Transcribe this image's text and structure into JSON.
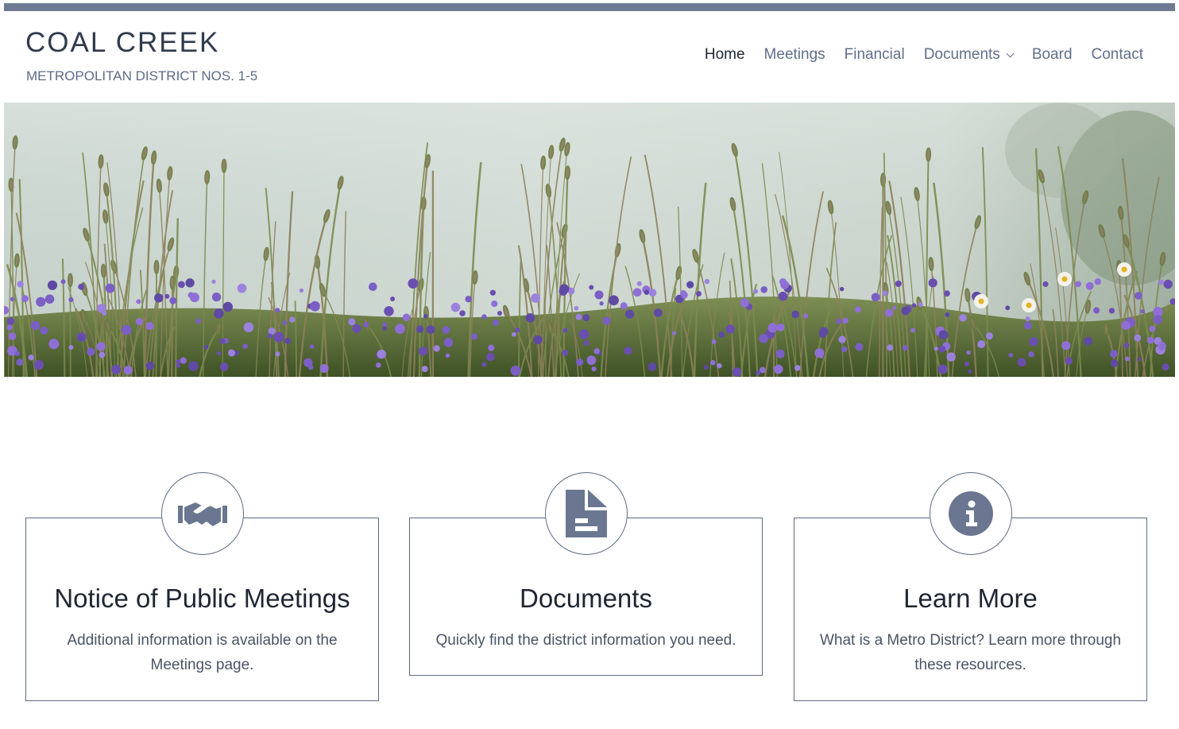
{
  "header": {
    "title": "COAL CREEK",
    "subtitle": "METROPOLITAN DISTRICT NOS. 1-5"
  },
  "nav": {
    "items": [
      {
        "label": "Home",
        "active": true
      },
      {
        "label": "Meetings"
      },
      {
        "label": "Financial"
      },
      {
        "label": "Documents",
        "has_dropdown": true
      },
      {
        "label": "Board"
      },
      {
        "label": "Contact"
      }
    ]
  },
  "colors": {
    "accent": "#6f7b92",
    "icon": "#6b7791",
    "text_dark": "#1f2633"
  },
  "cards": [
    {
      "icon": "handshake-icon",
      "title": "Notice of Public Meetings",
      "text": "Additional information is available on the Meetings page."
    },
    {
      "icon": "document-icon",
      "title": "Documents",
      "text": "Quickly find the district information you need."
    },
    {
      "icon": "info-icon",
      "title": "Learn More",
      "text": "What is a Metro District? Learn more through these resources."
    }
  ]
}
